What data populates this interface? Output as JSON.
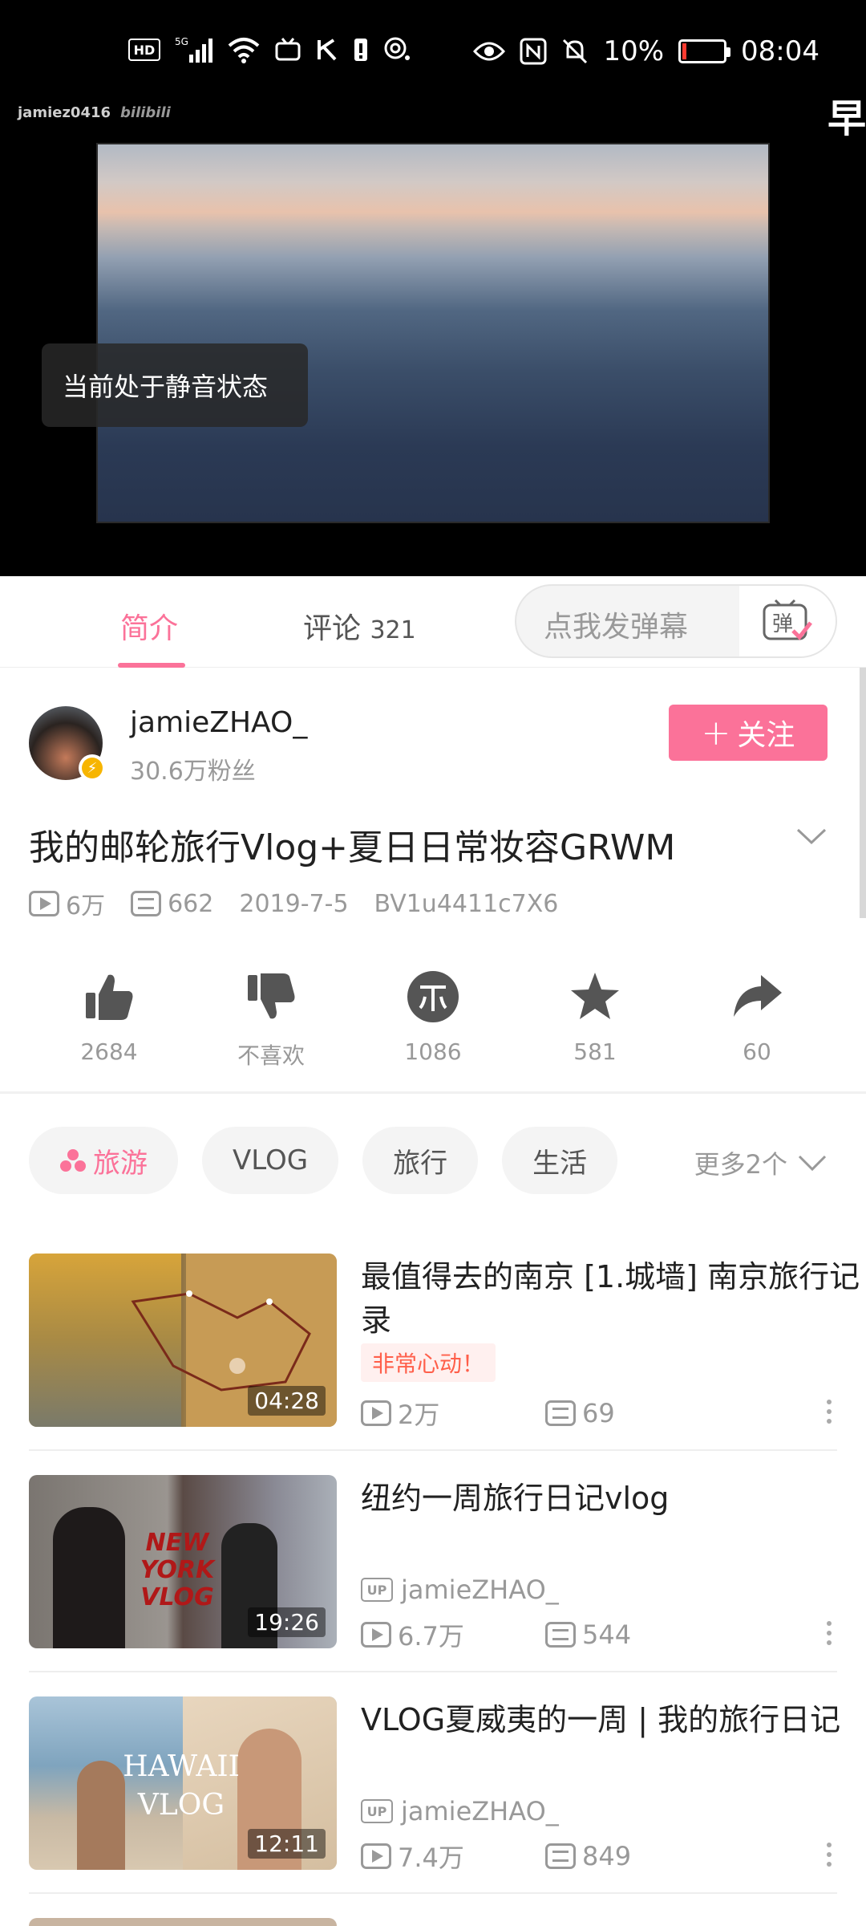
{
  "status_bar": {
    "left_icons": [
      "hd-icon",
      "5g-signal-icon",
      "wifi-icon",
      "tv-icon",
      "k-icon",
      "sim-icon",
      "hotspot-icon"
    ],
    "battery_percent": "10%",
    "battery_level": 0.1,
    "time": "08:04",
    "hd_label": "HD"
  },
  "player": {
    "watermark_user": "jamiez0416",
    "watermark_brand": "bilibili",
    "edge_char": "早",
    "toast": "当前处于静音状态"
  },
  "tabs": {
    "intro": "简介",
    "comments": "评论",
    "comment_count": "321",
    "danmu_placeholder": "点我发弹幕",
    "danmu_btn": "弹"
  },
  "uploader": {
    "name": "jamieZHAO_",
    "fans": "30.6万粉丝",
    "follow_label": "关注",
    "follow_plus": "+"
  },
  "video": {
    "title": "我的邮轮旅行Vlog+夏日日常妆容GRWM",
    "views": "6万",
    "danmaku": "662",
    "date": "2019-7-5",
    "bvid": "BV1u4411c7X6"
  },
  "actions": {
    "like": "2684",
    "dislike": "不喜欢",
    "coin": "1086",
    "favorite": "581",
    "share": "60"
  },
  "tags": {
    "items": [
      "旅游",
      "VLOG",
      "旅行",
      "生活"
    ],
    "more": "更多2个"
  },
  "related": [
    {
      "title": "最值得去的南京 [1.城墙] 南京旅行记录",
      "badge": "非常心动！",
      "duration": "04:28",
      "views": "2万",
      "danmaku": "69"
    },
    {
      "title": "纽约一周旅行日记vlog",
      "uploader": "jamieZHAO_",
      "duration": "19:26",
      "views": "6.7万",
      "danmaku": "544",
      "thumb_text_1": "NEW YORK",
      "thumb_text_2": "VLOG"
    },
    {
      "title": "VLOG夏威夷的一周 | 我的旅行日记",
      "uploader": "jamieZHAO_",
      "duration": "12:11",
      "views": "7.4万",
      "danmaku": "849",
      "thumb_text_1": "HAWAII",
      "thumb_text_2": "VLOG"
    }
  ],
  "up_label": "UP",
  "colors": {
    "brand_pink": "#fb7299",
    "hot_badge": "#ff5f4a",
    "gray_text": "#999999"
  }
}
